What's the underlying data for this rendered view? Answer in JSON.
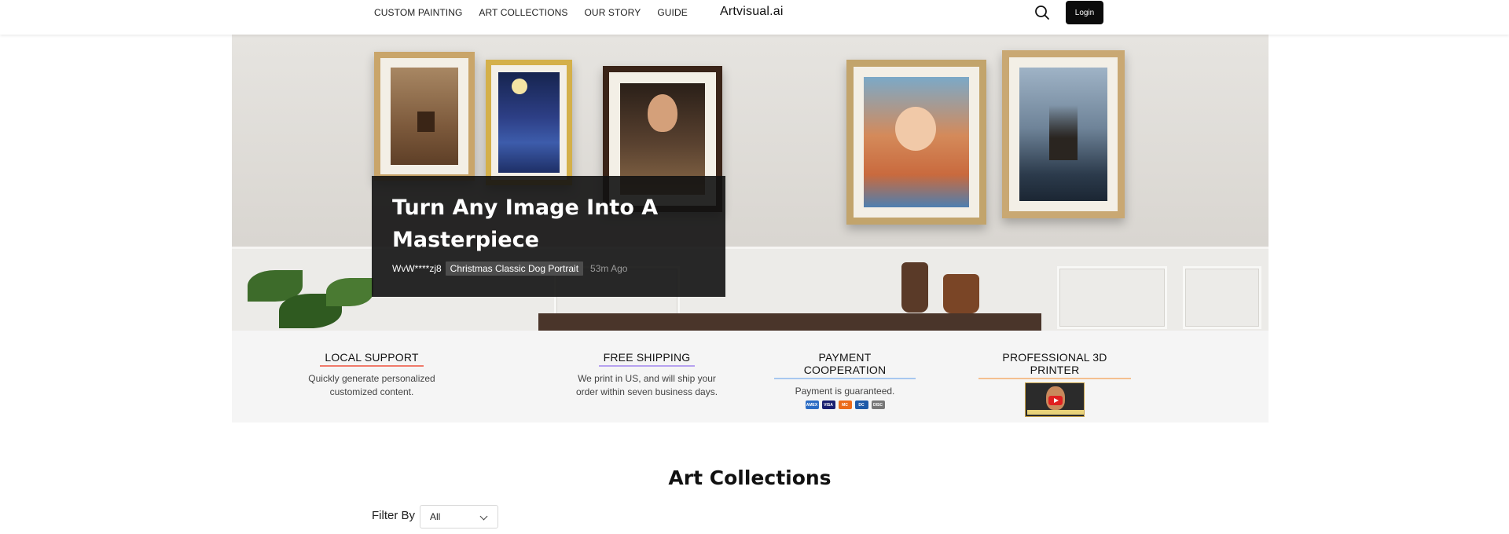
{
  "header": {
    "nav": [
      "CUSTOM PAINTING",
      "ART COLLECTIONS",
      "OUR STORY",
      "GUIDE"
    ],
    "brand": "Artvisual.ai",
    "search_icon": "search-icon",
    "login_label": "Login"
  },
  "hero": {
    "headline": "Turn Any Image Into A Masterpiece",
    "user": "WvW****zj8",
    "tag": "Christmas Classic Dog Portrait",
    "time": "53m Ago"
  },
  "features": [
    {
      "title": "LOCAL SUPPORT",
      "desc": "Quickly generate personalized customized content."
    },
    {
      "title": "FREE SHIPPING",
      "desc": "We print in US, and will ship your order within seven business days."
    },
    {
      "title": "PAYMENT COOPERATION",
      "desc": "Payment is guaranteed."
    },
    {
      "title": "PROFESSIONAL 3D PRINTER",
      "desc": ""
    }
  ],
  "payment_cards": [
    "AMEX",
    "VISA",
    "MC",
    "DC",
    "DISC"
  ],
  "collections": {
    "title": "Art Collections",
    "filter_label": "Filter By",
    "filter_value": "All"
  },
  "colors": {
    "overlay": "#121212",
    "login_bg": "#0b0b0b",
    "feature_bg": "#f5f5f5"
  }
}
